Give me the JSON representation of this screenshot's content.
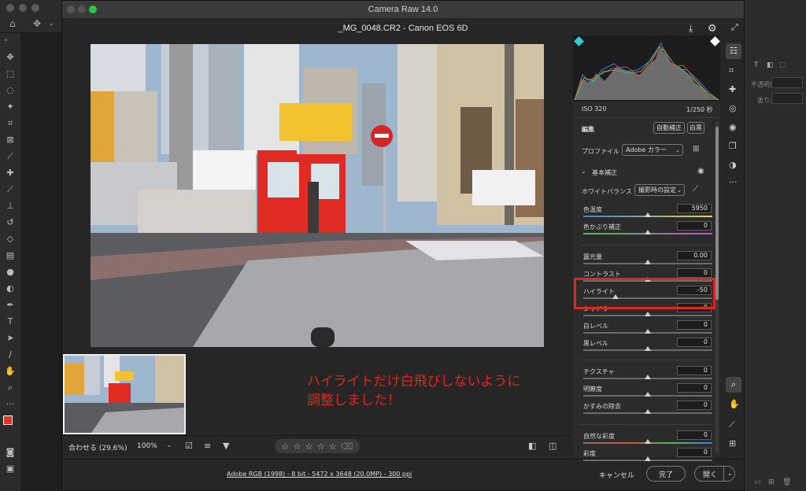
{
  "window": {
    "title": "Camera Raw 14.0",
    "file": "_MG_0048.CR2  -  Canon EOS 6D"
  },
  "histogram": {
    "iso": "ISO 320",
    "shutter": "1/250 秒"
  },
  "edit": {
    "title": "編集",
    "auto_label": "自動補正",
    "bw_label": "白黒",
    "profile_label": "プロファイル",
    "profile_value": "Adobe カラー",
    "basic_label": "基本補正",
    "wb_label": "ホワイトバランス",
    "wb_value": "撮影時の設定",
    "sliders": [
      {
        "label": "色温度",
        "value": "5950",
        "level": 0.5
      },
      {
        "label": "色かぶり補正",
        "value": "0",
        "level": 0.5
      },
      {
        "label": "露光量",
        "value": "0.00",
        "level": 0.5
      },
      {
        "label": "コントラスト",
        "value": "0",
        "level": 0.5
      },
      {
        "label": "ハイライト",
        "value": "-50",
        "level": 0.25
      },
      {
        "label": "シャドウ",
        "value": "0",
        "level": 0.5
      },
      {
        "label": "白レベル",
        "value": "0",
        "level": 0.5
      },
      {
        "label": "黒レベル",
        "value": "0",
        "level": 0.5
      },
      {
        "label": "テクスチャ",
        "value": "0",
        "level": 0.5
      },
      {
        "label": "明瞭度",
        "value": "0",
        "level": 0.5
      },
      {
        "label": "かすみの除去",
        "value": "0",
        "level": 0.5
      },
      {
        "label": "自然な彩度",
        "value": "0",
        "level": 0.5
      },
      {
        "label": "彩度",
        "value": "0",
        "level": 0.5
      }
    ]
  },
  "annotation": {
    "line1": "ハイライトだけ白飛びしないように",
    "line2": "調整しました！"
  },
  "bottom": {
    "zoom_fit": "合わせる (29.6%)",
    "zoom_100": "100%"
  },
  "footer": {
    "info": "Adobe RGB (1998) - 8 bit - 5472 x 3648 (20.0MP) - 300 ppi",
    "cancel": "キャンセル",
    "done": "完了",
    "open": "開く"
  },
  "ps_right": {
    "opacity": "不透明度：",
    "fill": "塗り："
  },
  "colors": {
    "accent_red": "#e0261b",
    "foreground": "#e8302a"
  }
}
